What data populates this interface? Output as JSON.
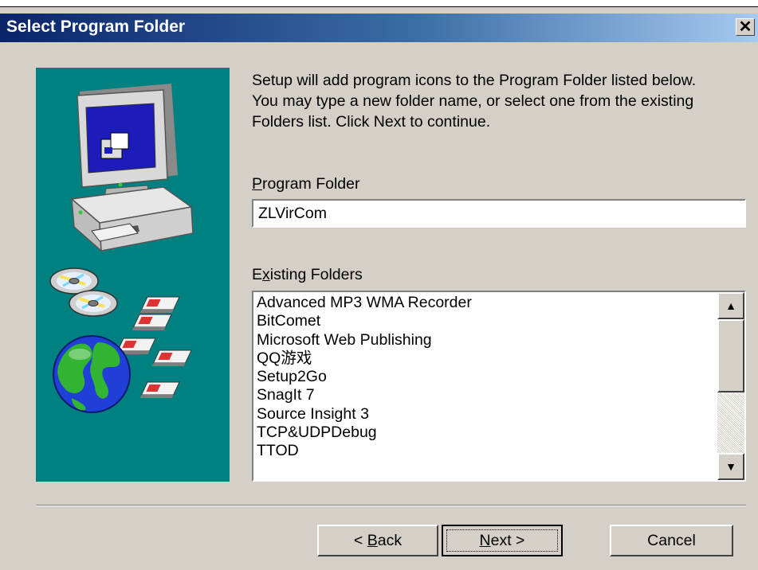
{
  "dialog": {
    "title": "Select Program Folder",
    "close_glyph": "✕"
  },
  "instructions": [
    "Setup will add program icons to the Program Folder listed below.",
    "You may type a new folder name, or select one from the existing",
    "Folders list. Click Next to continue."
  ],
  "program_folder": {
    "label_mnemonic": "P",
    "label_rest": "rogram Folder",
    "value": "ZLVirCom"
  },
  "existing_folders": {
    "label_start": "E",
    "label_mnemonic": "x",
    "label_rest": "isting Folders",
    "items": [
      "Advanced MP3 WMA Recorder",
      "BitComet",
      "Microsoft Web Publishing",
      "QQ游戏",
      "Setup2Go",
      "SnagIt 7",
      "Source Insight 3",
      "TCP&UDPDebug",
      "TTOD"
    ],
    "scroll_position": 0.0
  },
  "buttons": {
    "back_prefix": "< ",
    "back_mnemonic": "B",
    "back_rest": "ack",
    "next_mnemonic": "N",
    "next_rest": "ext >",
    "cancel": "Cancel"
  },
  "icons": {
    "computer": "computer-icon",
    "cds": "cd-icon",
    "floppies": "floppy-disk-icon",
    "globe": "globe-icon"
  },
  "colors": {
    "panel_background": "#008080",
    "dialog_face": "#d4d0c8",
    "titlebar_start": "#0a246a",
    "titlebar_end": "#a6caf0"
  }
}
